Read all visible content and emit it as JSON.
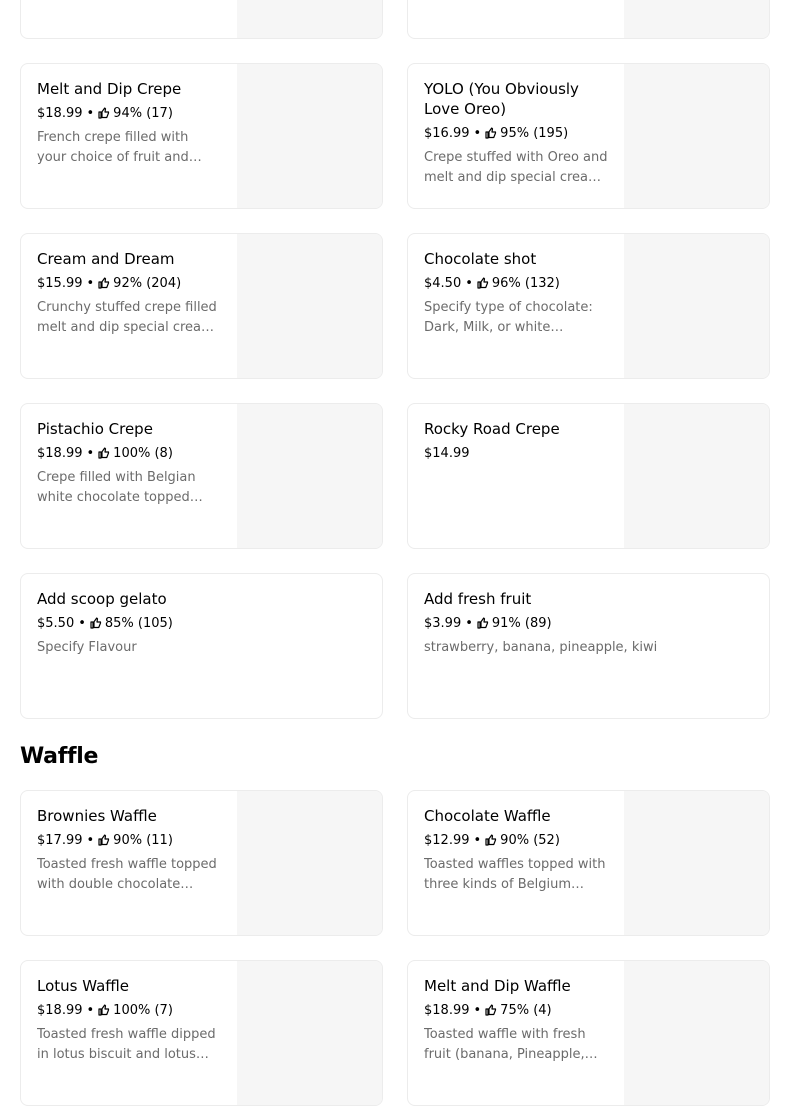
{
  "crepes_partial": [
    {},
    {}
  ],
  "crepes": [
    {
      "name": "Melt and Dip Crepe",
      "price": "$18.99",
      "rating": "94% (17)",
      "description": "French crepe filled with your choice of fruit and topped with melt and dip special cream."
    },
    {
      "name": "YOLO (You Obviously Love Oreo)",
      "price": "$16.99",
      "rating": "95% (195)",
      "description": "Crepe stuffed with Oreo and melt and dip special cream topped with Oreo."
    },
    {
      "name": "Cream and Dream",
      "price": "$15.99",
      "rating": "92% (204)",
      "description": "Crunchy stuffed crepe filled melt and dip special cream topped with chocolate."
    },
    {
      "name": "Chocolate shot",
      "price": "$4.50",
      "rating": "96% (132)",
      "description": "Specify type of chocolate: Dark, Milk, or white chocolate."
    },
    {
      "name": "Pistachio Crepe",
      "price": "$18.99",
      "rating": "100% (8)",
      "description": "Crepe filled with Belgian white chocolate topped with pistachio."
    },
    {
      "name": "Rocky Road Crepe",
      "price": "$14.99",
      "rating": "",
      "description": ""
    },
    {
      "name": "Add scoop gelato",
      "price": "$5.50",
      "rating": "85% (105)",
      "description": "Specify Flavour",
      "no_thumb": true
    },
    {
      "name": "Add fresh fruit",
      "price": "$3.99",
      "rating": "91% (89)",
      "description": "strawberry, banana, pineapple, kiwi",
      "no_thumb": true
    }
  ],
  "waffle_section": {
    "title": "Waffle"
  },
  "waffles": [
    {
      "name": "Brownies Waffle",
      "price": "$17.99",
      "rating": "90% (11)",
      "description": "Toasted fresh waffle topped with double chocolate brownies."
    },
    {
      "name": "Chocolate Waffle",
      "price": "$12.99",
      "rating": "90% (52)",
      "description": "Toasted waffles topped with three kinds of Belgium chocolate."
    },
    {
      "name": "Lotus Waffle",
      "price": "$18.99",
      "rating": "100% (7)",
      "description": "Toasted fresh waffle dipped in lotus biscuit and lotus cream."
    },
    {
      "name": "Melt and Dip Waffle",
      "price": "$18.99",
      "rating": "75% (4)",
      "description": "Toasted waffle with fresh fruit (banana, Pineapple, strawberry)."
    }
  ],
  "icons": {
    "rating": "thumbs-up-icon"
  },
  "colors": {
    "text_primary": "#000000",
    "text_secondary": "#6b6b6b",
    "card_border": "#ececec",
    "thumb_bg": "#f6f6f6"
  }
}
